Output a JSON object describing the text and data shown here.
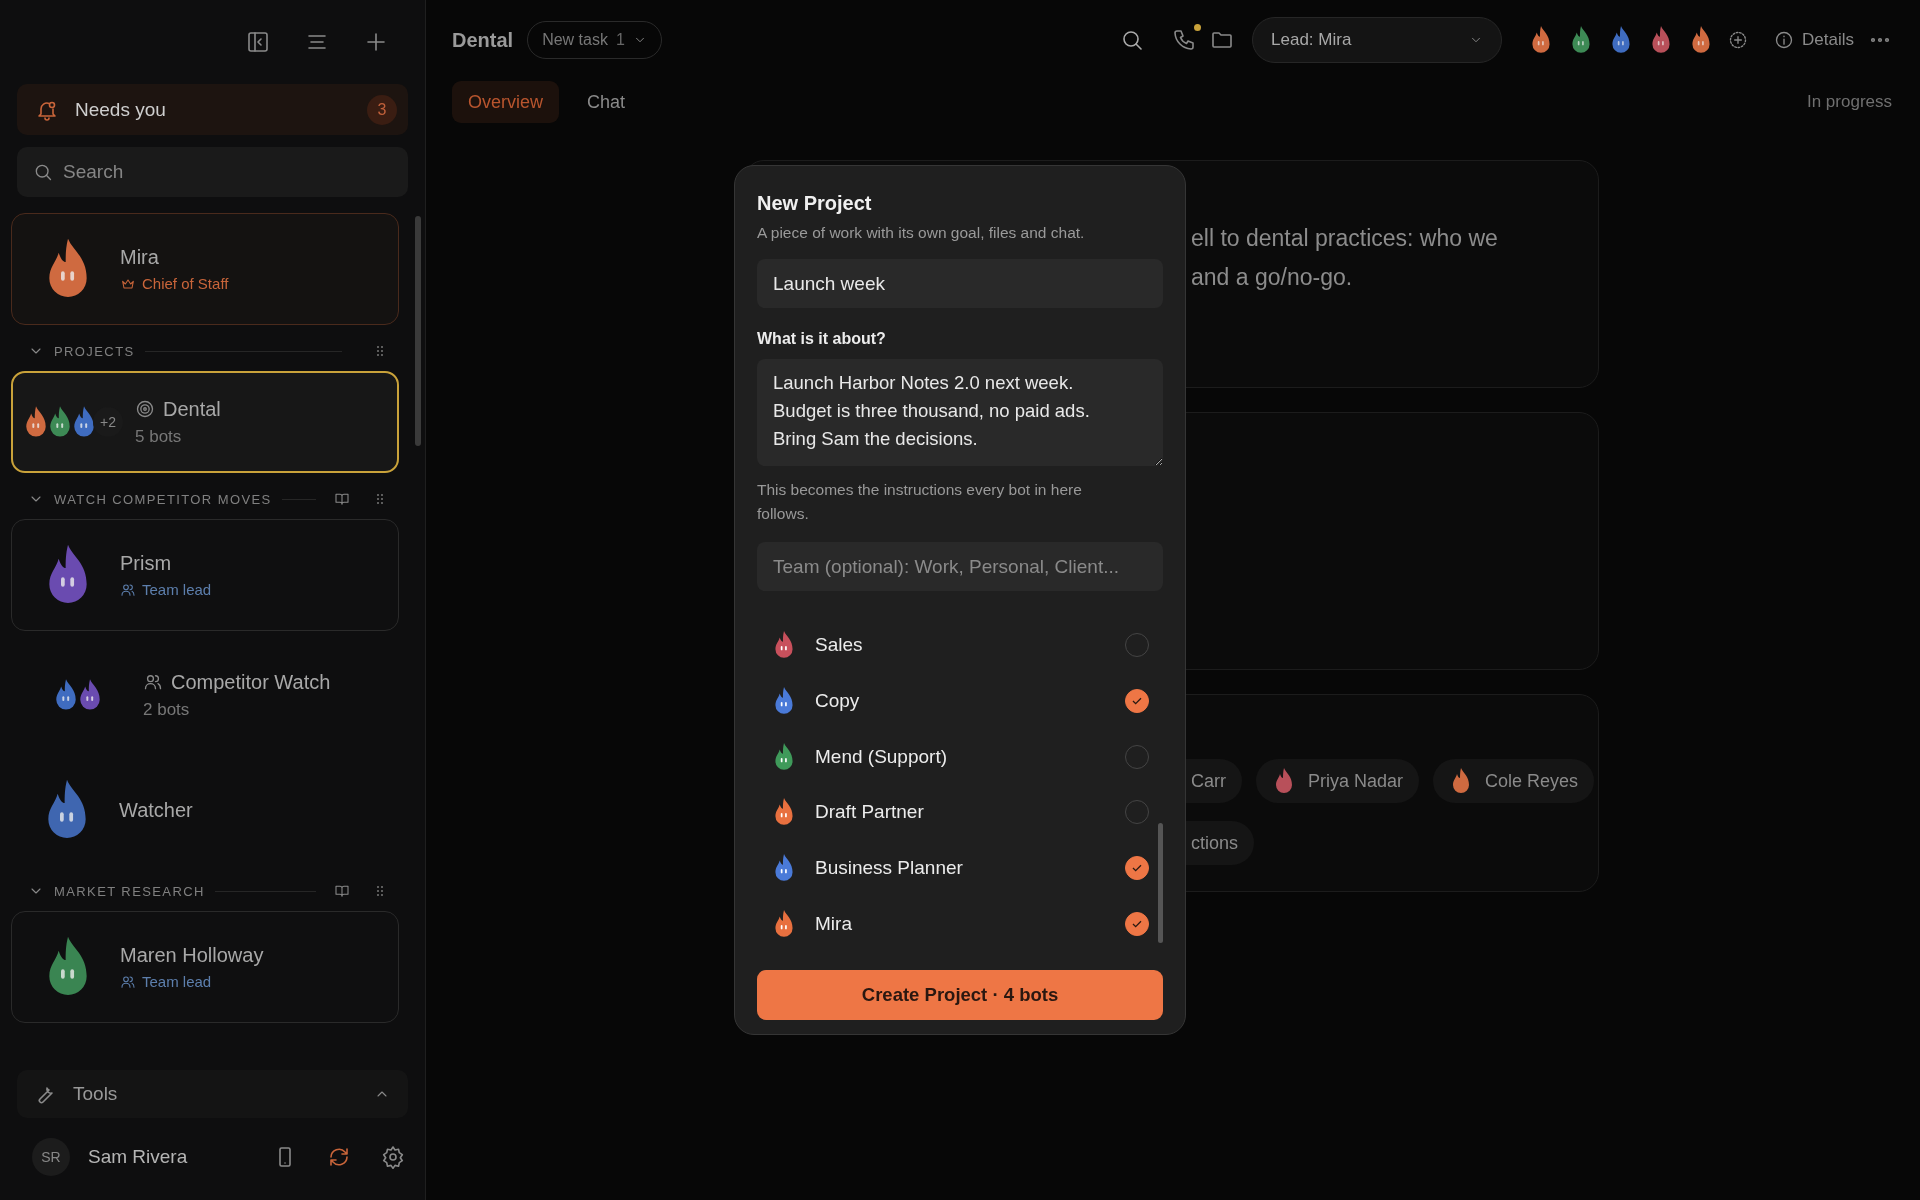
{
  "sidebar": {
    "needs_you": {
      "label": "Needs you",
      "count": "3"
    },
    "search": {
      "placeholder": "Search"
    },
    "pinned": {
      "name": "Mira",
      "role": "Chief of Staff",
      "color": "#cf6a40"
    },
    "sections": [
      {
        "title": "PROJECTS",
        "expanded": true,
        "book": false,
        "items": [
          {
            "kind": "project",
            "name": "Dental",
            "meta": "5 bots",
            "selected": true,
            "avatars": [
              {
                "color": "#cf6a40"
              },
              {
                "color": "#3d8a55"
              },
              {
                "color": "#3f6cc0"
              }
            ],
            "more": "+2"
          }
        ]
      },
      {
        "title": "WATCH COMPETITOR MOVES",
        "expanded": true,
        "book": true,
        "items": [
          {
            "kind": "lead",
            "name": "Prism",
            "role": "Team lead",
            "selected": false,
            "avatars": [
              {
                "color": "#6a4bb0"
              }
            ]
          },
          {
            "kind": "team",
            "name": "Competitor Watch",
            "meta": "2 bots",
            "selected": false,
            "avatars": [
              {
                "color": "#3f6cc0"
              },
              {
                "color": "#6a4bb0"
              }
            ]
          },
          {
            "kind": "bot",
            "name": "Watcher",
            "selected": false,
            "avatars": [
              {
                "color": "#3f66b0"
              }
            ]
          }
        ]
      },
      {
        "title": "MARKET RESEARCH",
        "expanded": true,
        "book": true,
        "items": [
          {
            "kind": "lead",
            "name": "Maren Holloway",
            "role": "Team lead",
            "selected": false,
            "avatars": [
              {
                "color": "#3a8552"
              }
            ]
          }
        ]
      }
    ],
    "tools": {
      "label": "Tools",
      "expanded": true
    },
    "user": {
      "initials": "SR",
      "name": "Sam Rivera"
    }
  },
  "header": {
    "title": "Dental",
    "new_task": {
      "label": "New task",
      "count": "1"
    },
    "call_alert": true,
    "lead": "Lead: Mira",
    "avatars": [
      {
        "color": "#cf6a40"
      },
      {
        "color": "#3d8a55"
      },
      {
        "color": "#3f6cc0"
      },
      {
        "color": "#b8505a"
      },
      {
        "color": "#cf6a40"
      }
    ],
    "details": "Details"
  },
  "tabs": [
    {
      "label": "Overview",
      "selected": true
    },
    {
      "label": "Chat",
      "selected": false
    }
  ],
  "status": "In progress",
  "cards": [
    {
      "kind": "text",
      "lines": [
        "ell to dental practices: who we",
        "and a go/no-go."
      ]
    },
    {
      "kind": "empty"
    },
    {
      "kind": "chips",
      "rows": [
        [
          {
            "label": "Carr"
          },
          {
            "label": "Priya Nadar",
            "color": "#b8505a"
          },
          {
            "label": "Cole Reyes",
            "color": "#cf6a40"
          }
        ],
        [
          {
            "label": "ctions"
          }
        ]
      ]
    }
  ],
  "modal": {
    "title": "New Project",
    "subtitle": "A piece of work with its own goal, files and chat.",
    "name_value": "Launch week",
    "about_label": "What is it about?",
    "about_value": "Launch Harbor Notes 2.0 next week.\nBudget is three thousand, no paid ads.\nBring Sam the decisions.",
    "hint": "This becomes the instructions every bot in here follows.",
    "team_placeholder": "Team (optional): Work, Personal, Client...",
    "bots": [
      {
        "name": "Sales",
        "color": "#c8505c",
        "checked": false
      },
      {
        "name": "Copy",
        "color": "#4a7ad8",
        "checked": true
      },
      {
        "name": "Mend (Support)",
        "color": "#3f9a5a",
        "checked": false
      },
      {
        "name": "Draft Partner",
        "color": "#e8703f",
        "checked": false
      },
      {
        "name": "Business Planner",
        "color": "#4a7ad8",
        "checked": true
      },
      {
        "name": "Mira",
        "color": "#e8703f",
        "checked": true
      }
    ],
    "create": "Create Project · 4 bots"
  }
}
